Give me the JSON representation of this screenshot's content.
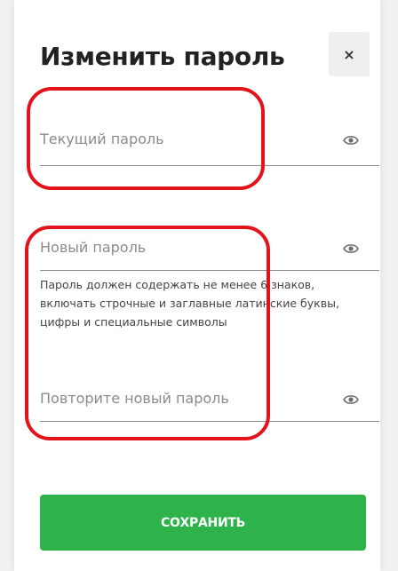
{
  "dialog": {
    "title": "Изменить пароль",
    "close_label": "×"
  },
  "fields": {
    "current_password": {
      "placeholder": "Текущий пароль",
      "icon": "eye-icon"
    },
    "new_password": {
      "placeholder": "Новый пароль",
      "icon": "eye-icon"
    },
    "repeat_password": {
      "placeholder": "Повторите новый пароль",
      "icon": "eye-icon"
    }
  },
  "hint": "Пароль должен содержать не менее 6 знаков, включать строчные и заглавные латинские буквы, цифры и специальные символы",
  "save_button": {
    "label": "СОХРАНИТЬ"
  },
  "colors": {
    "accent": "#2db34a",
    "annotation": "#e3131b",
    "text": "#222222",
    "placeholder": "#8b8b8b"
  }
}
